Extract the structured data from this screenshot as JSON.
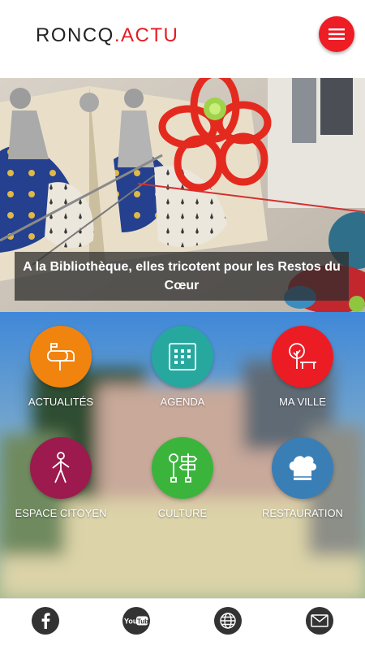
{
  "header": {
    "logo_main": "RONCQ",
    "logo_accent": ".ACTU",
    "menu_icon": "hamburger-menu-icon"
  },
  "hero": {
    "caption": "A la Bibliothèque, elles tricotent pour les Restos du Cœur"
  },
  "tiles": [
    {
      "label": "ACTUALITÉS",
      "icon": "mailbox-icon",
      "color": "#f0840f"
    },
    {
      "label": "AGENDA",
      "icon": "calendar-icon",
      "color": "#27a89e"
    },
    {
      "label": "MA VILLE",
      "icon": "tree-bench-icon",
      "color": "#ec1c24"
    },
    {
      "label": "ESPACE CITOYEN",
      "icon": "person-icon",
      "color": "#9c1a4e"
    },
    {
      "label": "CULTURE",
      "icon": "signpost-icon",
      "color": "#3bb43c"
    },
    {
      "label": "RESTAURATION",
      "icon": "chef-hat-icon",
      "color": "#3a7eb6"
    }
  ],
  "footer": {
    "icons": [
      "facebook-icon",
      "youtube-icon",
      "globe-icon",
      "mail-icon"
    ],
    "youtube_text": "YouTube"
  }
}
